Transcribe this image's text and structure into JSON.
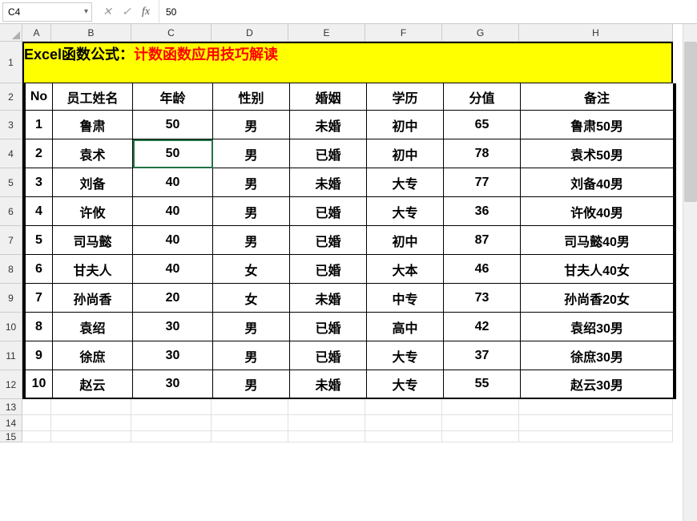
{
  "formula_bar": {
    "name_box": "C4",
    "cancel_icon": "✕",
    "confirm_icon": "✓",
    "fx_icon": "fx",
    "formula_value": "50"
  },
  "columns": [
    "A",
    "B",
    "C",
    "D",
    "E",
    "F",
    "G",
    "H"
  ],
  "row_heads": [
    "1",
    "2",
    "3",
    "4",
    "5",
    "6",
    "7",
    "8",
    "9",
    "10",
    "11",
    "12",
    "13",
    "14",
    "15"
  ],
  "title": {
    "prefix": "Excel函数公式：",
    "suffix": "计数函数应用技巧解读"
  },
  "headers": [
    "No",
    "员工姓名",
    "年龄",
    "性别",
    "婚姻",
    "学历",
    "分值",
    "备注"
  ],
  "rows": [
    {
      "no": "1",
      "name": "鲁肃",
      "age": "50",
      "gender": "男",
      "marital": "未婚",
      "edu": "初中",
      "score": "65",
      "note": "鲁肃50男"
    },
    {
      "no": "2",
      "name": "袁术",
      "age": "50",
      "gender": "男",
      "marital": "已婚",
      "edu": "初中",
      "score": "78",
      "note": "袁术50男"
    },
    {
      "no": "3",
      "name": "刘备",
      "age": "40",
      "gender": "男",
      "marital": "未婚",
      "edu": "大专",
      "score": "77",
      "note": "刘备40男"
    },
    {
      "no": "4",
      "name": "许攸",
      "age": "40",
      "gender": "男",
      "marital": "已婚",
      "edu": "大专",
      "score": "36",
      "note": "许攸40男"
    },
    {
      "no": "5",
      "name": "司马懿",
      "age": "40",
      "gender": "男",
      "marital": "已婚",
      "edu": "初中",
      "score": "87",
      "note": "司马懿40男"
    },
    {
      "no": "6",
      "name": "甘夫人",
      "age": "40",
      "gender": "女",
      "marital": "已婚",
      "edu": "大本",
      "score": "46",
      "note": "甘夫人40女"
    },
    {
      "no": "7",
      "name": "孙尚香",
      "age": "20",
      "gender": "女",
      "marital": "未婚",
      "edu": "中专",
      "score": "73",
      "note": "孙尚香20女"
    },
    {
      "no": "8",
      "name": "袁绍",
      "age": "30",
      "gender": "男",
      "marital": "已婚",
      "edu": "高中",
      "score": "42",
      "note": "袁绍30男"
    },
    {
      "no": "9",
      "name": "徐庶",
      "age": "30",
      "gender": "男",
      "marital": "已婚",
      "edu": "大专",
      "score": "37",
      "note": "徐庶30男"
    },
    {
      "no": "10",
      "name": "赵云",
      "age": "30",
      "gender": "男",
      "marital": "未婚",
      "edu": "大专",
      "score": "55",
      "note": "赵云30男"
    }
  ],
  "selected_cell": "C4"
}
